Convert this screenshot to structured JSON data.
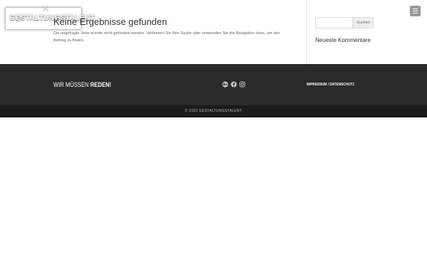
{
  "header": {
    "logo_text": "GESTALTUNGSTALENT"
  },
  "content": {
    "title": "Keine Ergebnisse gefunden",
    "text": "Die angefragte Seite konnte nicht gefunden werden. Verfeinern Sie Ihre Suche oder verwenden Sie die Navigation oben, um den Beitrag zu finden."
  },
  "sidebar": {
    "search_placeholder": "",
    "search_button": "Suchen",
    "widget_title": "Neueste Kommentare"
  },
  "footer": {
    "tagline_light": "WIR MÜSSEN",
    "tagline_bold": "REDEN!",
    "social_icons": [
      "behance-icon",
      "facebook-icon",
      "instagram-icon"
    ],
    "link_impressum": "IMPRESSUM",
    "link_separator": "/",
    "link_datenschutz": "DATENSCHUTZ",
    "copyright": "© 2020 GESTALTUNGSTALENT"
  },
  "colors": {
    "footer_bg": "#2a2a2a",
    "footer_bottom_bg": "#1b1b1b",
    "menu_button": "#999999"
  }
}
